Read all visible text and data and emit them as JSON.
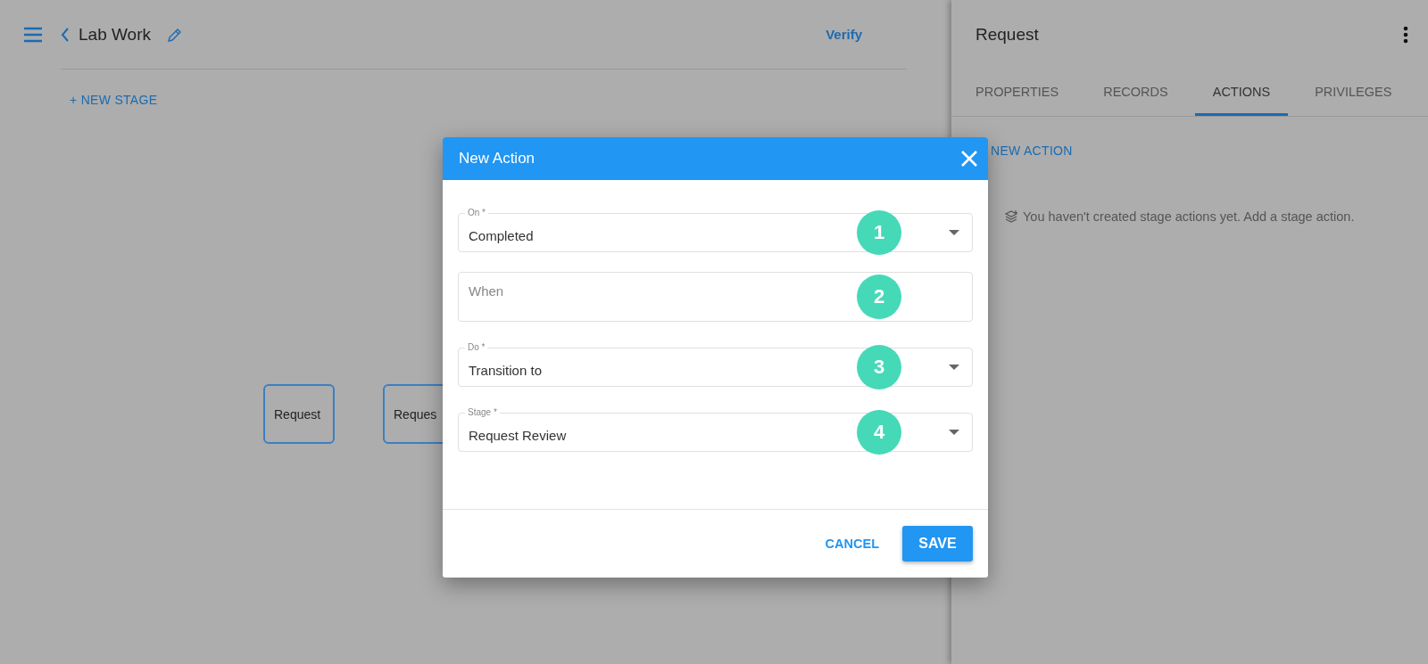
{
  "header": {
    "title": "Lab Work",
    "verify": "Verify",
    "new_stage": "+ NEW STAGE"
  },
  "stages": [
    {
      "label": "Request"
    },
    {
      "label": "Reques"
    }
  ],
  "panel": {
    "title": "Request",
    "tabs": [
      {
        "label": "PROPERTIES",
        "selected": false
      },
      {
        "label": "RECORDS",
        "selected": false
      },
      {
        "label": "ACTIONS",
        "selected": true
      },
      {
        "label": "PRIVILEGES",
        "selected": false
      }
    ],
    "new_action": "NEW ACTION",
    "empty_message": "You haven't created stage actions yet. Add a stage action."
  },
  "dialog": {
    "title": "New Action",
    "fields": [
      {
        "kind": "select",
        "label": "On *",
        "value": "Completed",
        "badge": "1"
      },
      {
        "kind": "text",
        "placeholder": "When",
        "badge": "2"
      },
      {
        "kind": "select",
        "label": "Do *",
        "value": "Transition to",
        "badge": "3"
      },
      {
        "kind": "select",
        "label": "Stage *",
        "value": "Request Review",
        "badge": "4"
      }
    ],
    "cancel": "CANCEL",
    "save": "SAVE"
  }
}
